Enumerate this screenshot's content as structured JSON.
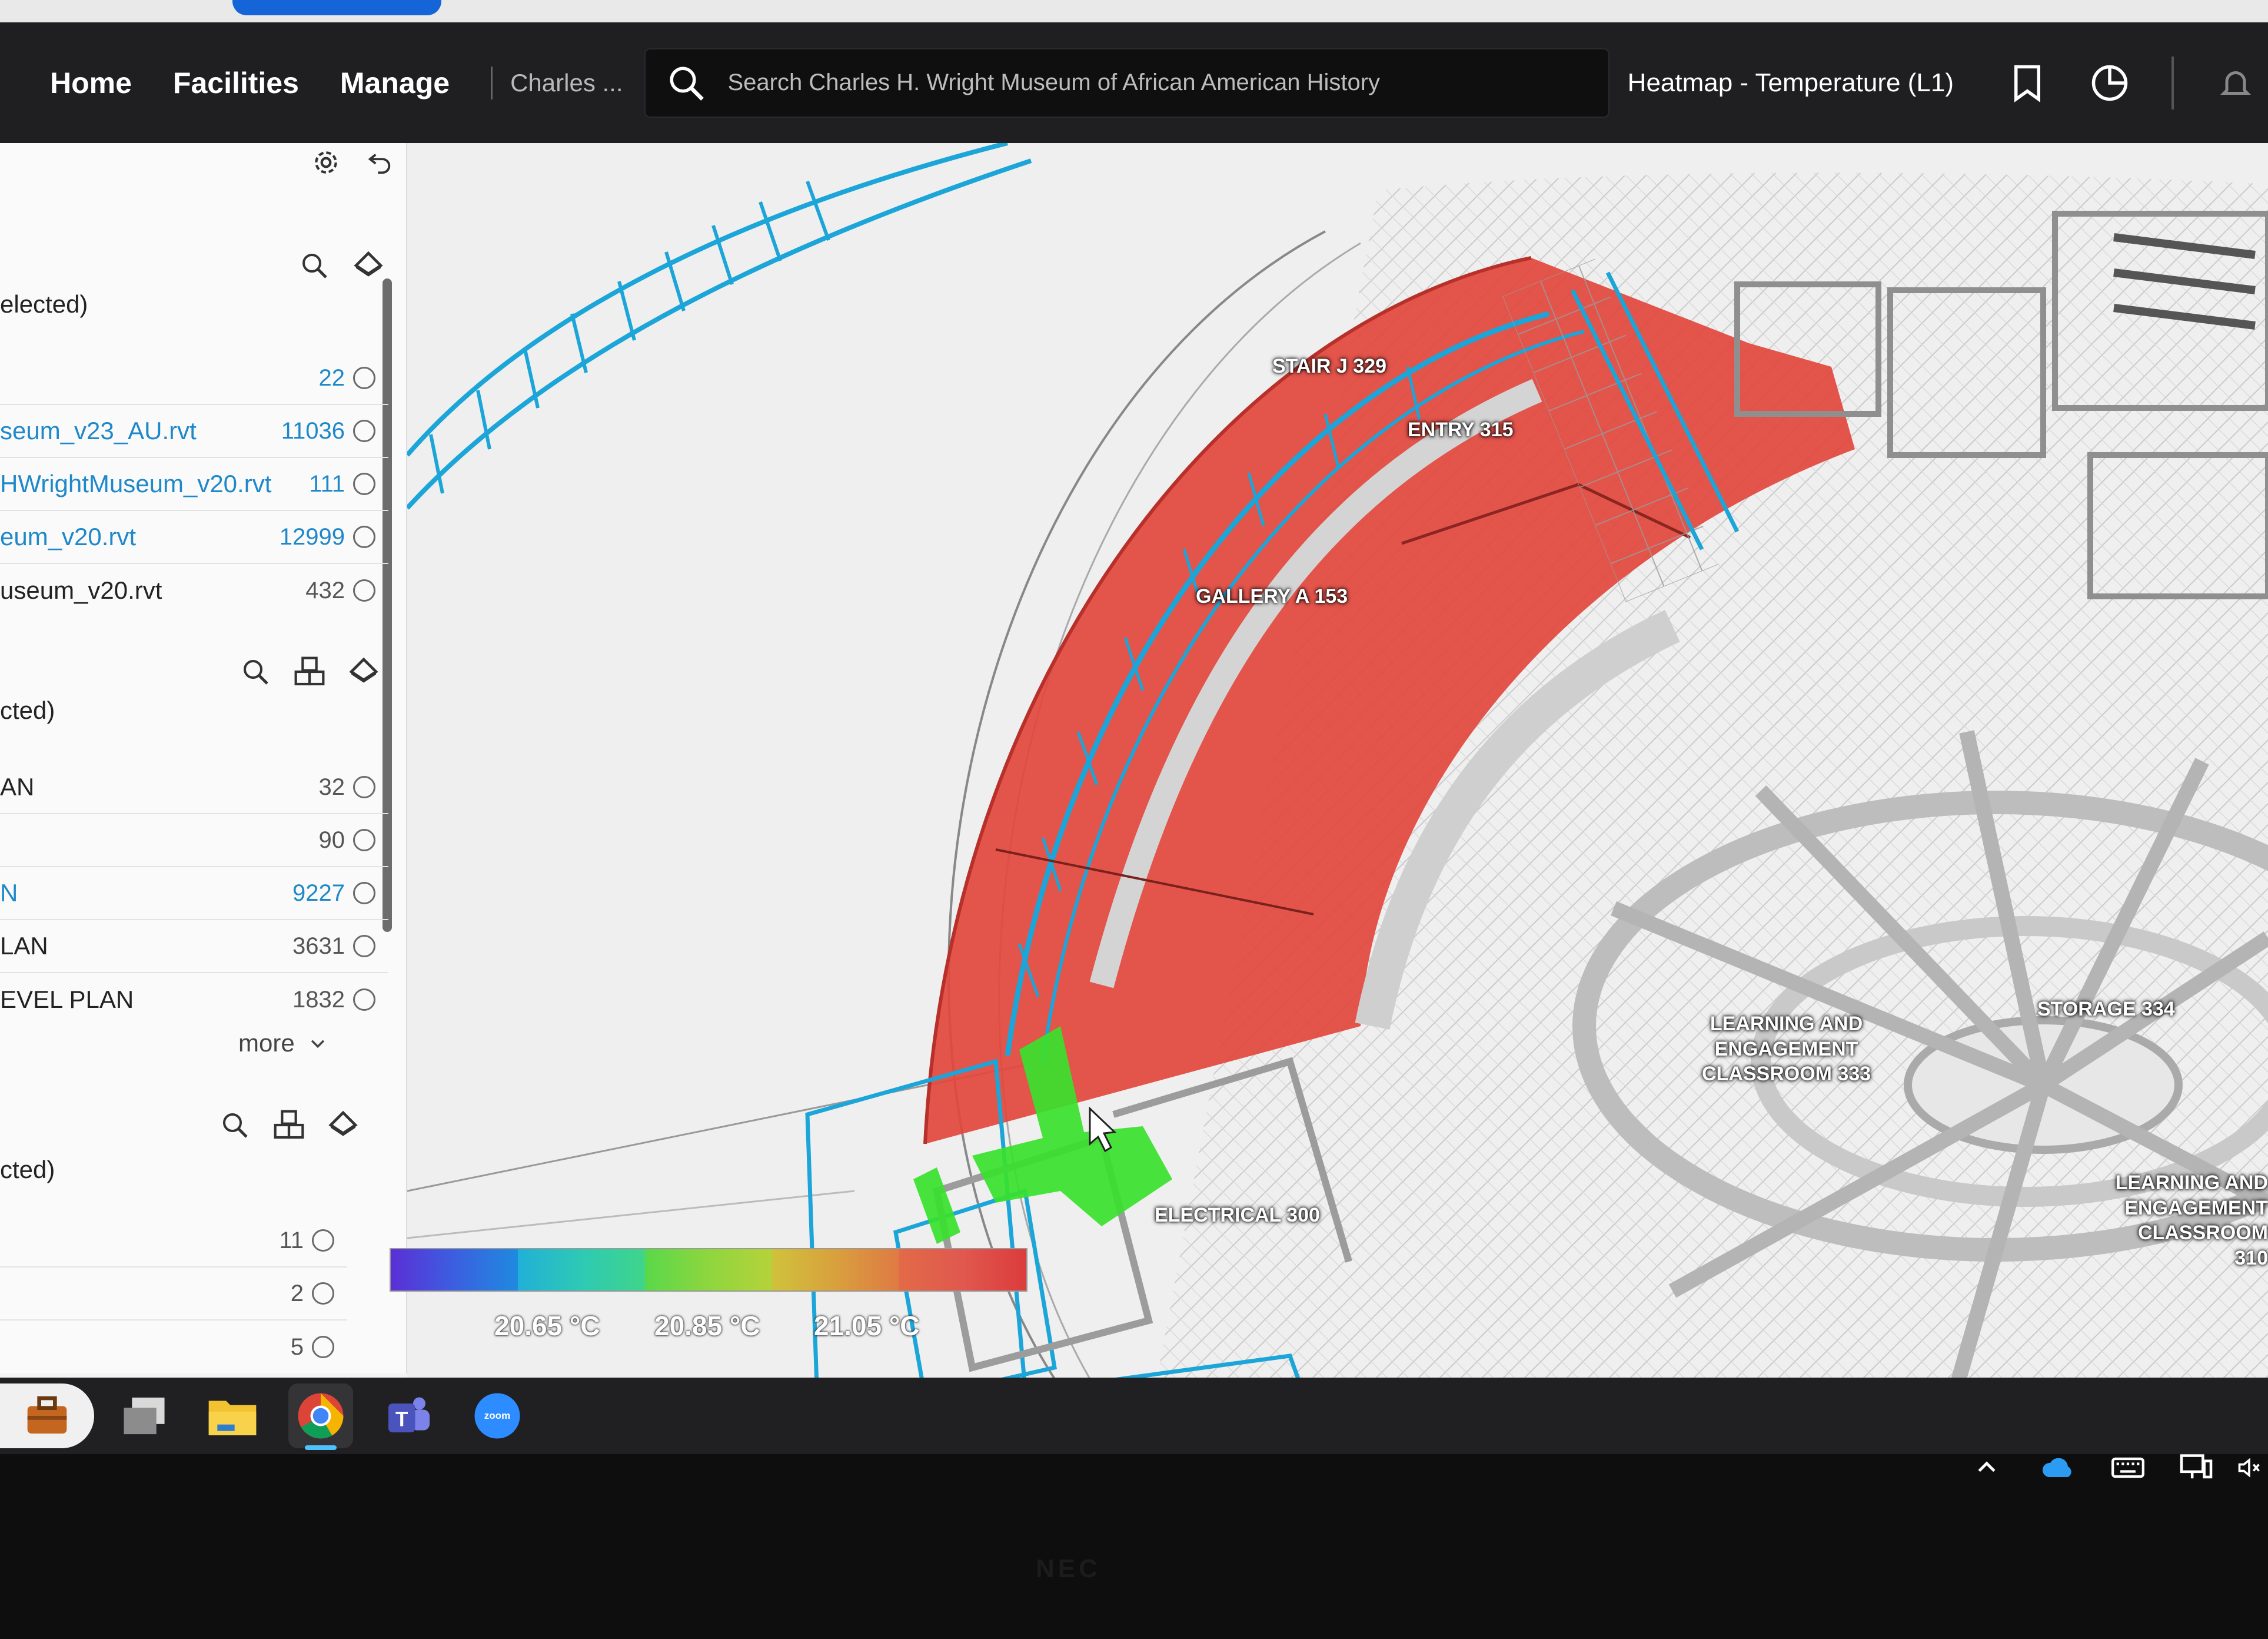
{
  "header": {
    "nav": [
      "Home",
      "Facilities",
      "Manage"
    ],
    "breadcrumb": "Charles ...",
    "search_placeholder": "Search Charles H. Wright Museum of African American History",
    "view_title": "Heatmap - Temperature (L1)"
  },
  "panel": {
    "section1": {
      "label": "elected)",
      "rows": [
        {
          "name": "",
          "count": "22",
          "link": false
        },
        {
          "name": "seum_v23_AU.rvt",
          "count": "11036",
          "link": true
        },
        {
          "name": "HWrightMuseum_v20.rvt",
          "count": "111",
          "link": true
        },
        {
          "name": "eum_v20.rvt",
          "count": "12999",
          "link": true
        },
        {
          "name": "useum_v20.rvt",
          "count": "432",
          "link": false
        }
      ]
    },
    "section2": {
      "label": "cted)",
      "rows": [
        {
          "name": "AN",
          "count": "32",
          "link": false
        },
        {
          "name": "",
          "count": "90",
          "link": false
        },
        {
          "name": "N",
          "count": "9227",
          "link": true
        },
        {
          "name": "LAN",
          "count": "3631",
          "link": false
        },
        {
          "name": "EVEL PLAN",
          "count": "1832",
          "link": false
        }
      ],
      "more": "more"
    },
    "section3": {
      "label": "cted)",
      "rows": [
        {
          "name": "",
          "count": "11",
          "link": false
        },
        {
          "name": "",
          "count": "2",
          "link": false
        },
        {
          "name": "",
          "count": "5",
          "link": false
        }
      ]
    }
  },
  "viewport": {
    "rooms": [
      {
        "label": "STAIR J 329"
      },
      {
        "label": "ENTRY 315"
      },
      {
        "label": "GALLERY A 153"
      },
      {
        "label": "STORAGE 334"
      },
      {
        "label": "LEARNING AND\nENGAGEMENT\nCLASSROOM 333"
      },
      {
        "label": "LEARNING AND\nENGAGEMENT\nCLASSROOM 310"
      },
      {
        "label": "ELECTRICAL 300"
      }
    ],
    "legend": {
      "labels": [
        "20.65 °C",
        "20.85 °C",
        "21.05 °C"
      ],
      "colors": [
        "#5b2fd6",
        "#2ec9b4",
        "#59d84a",
        "#cfc23c",
        "#e0584e"
      ]
    }
  },
  "colors": {
    "heat_red": "#e2463d",
    "cool_green": "#38e22c",
    "structure_blue": "#1ba5d8",
    "header_bg": "#1f1f21"
  },
  "taskbar": {
    "apps": [
      "briefcase-icon",
      "task-view-icon",
      "file-explorer-icon",
      "chrome-icon",
      "teams-icon",
      "zoom-icon"
    ],
    "zoom_label": "zoom"
  },
  "bezel": {
    "brand": "NEC"
  }
}
